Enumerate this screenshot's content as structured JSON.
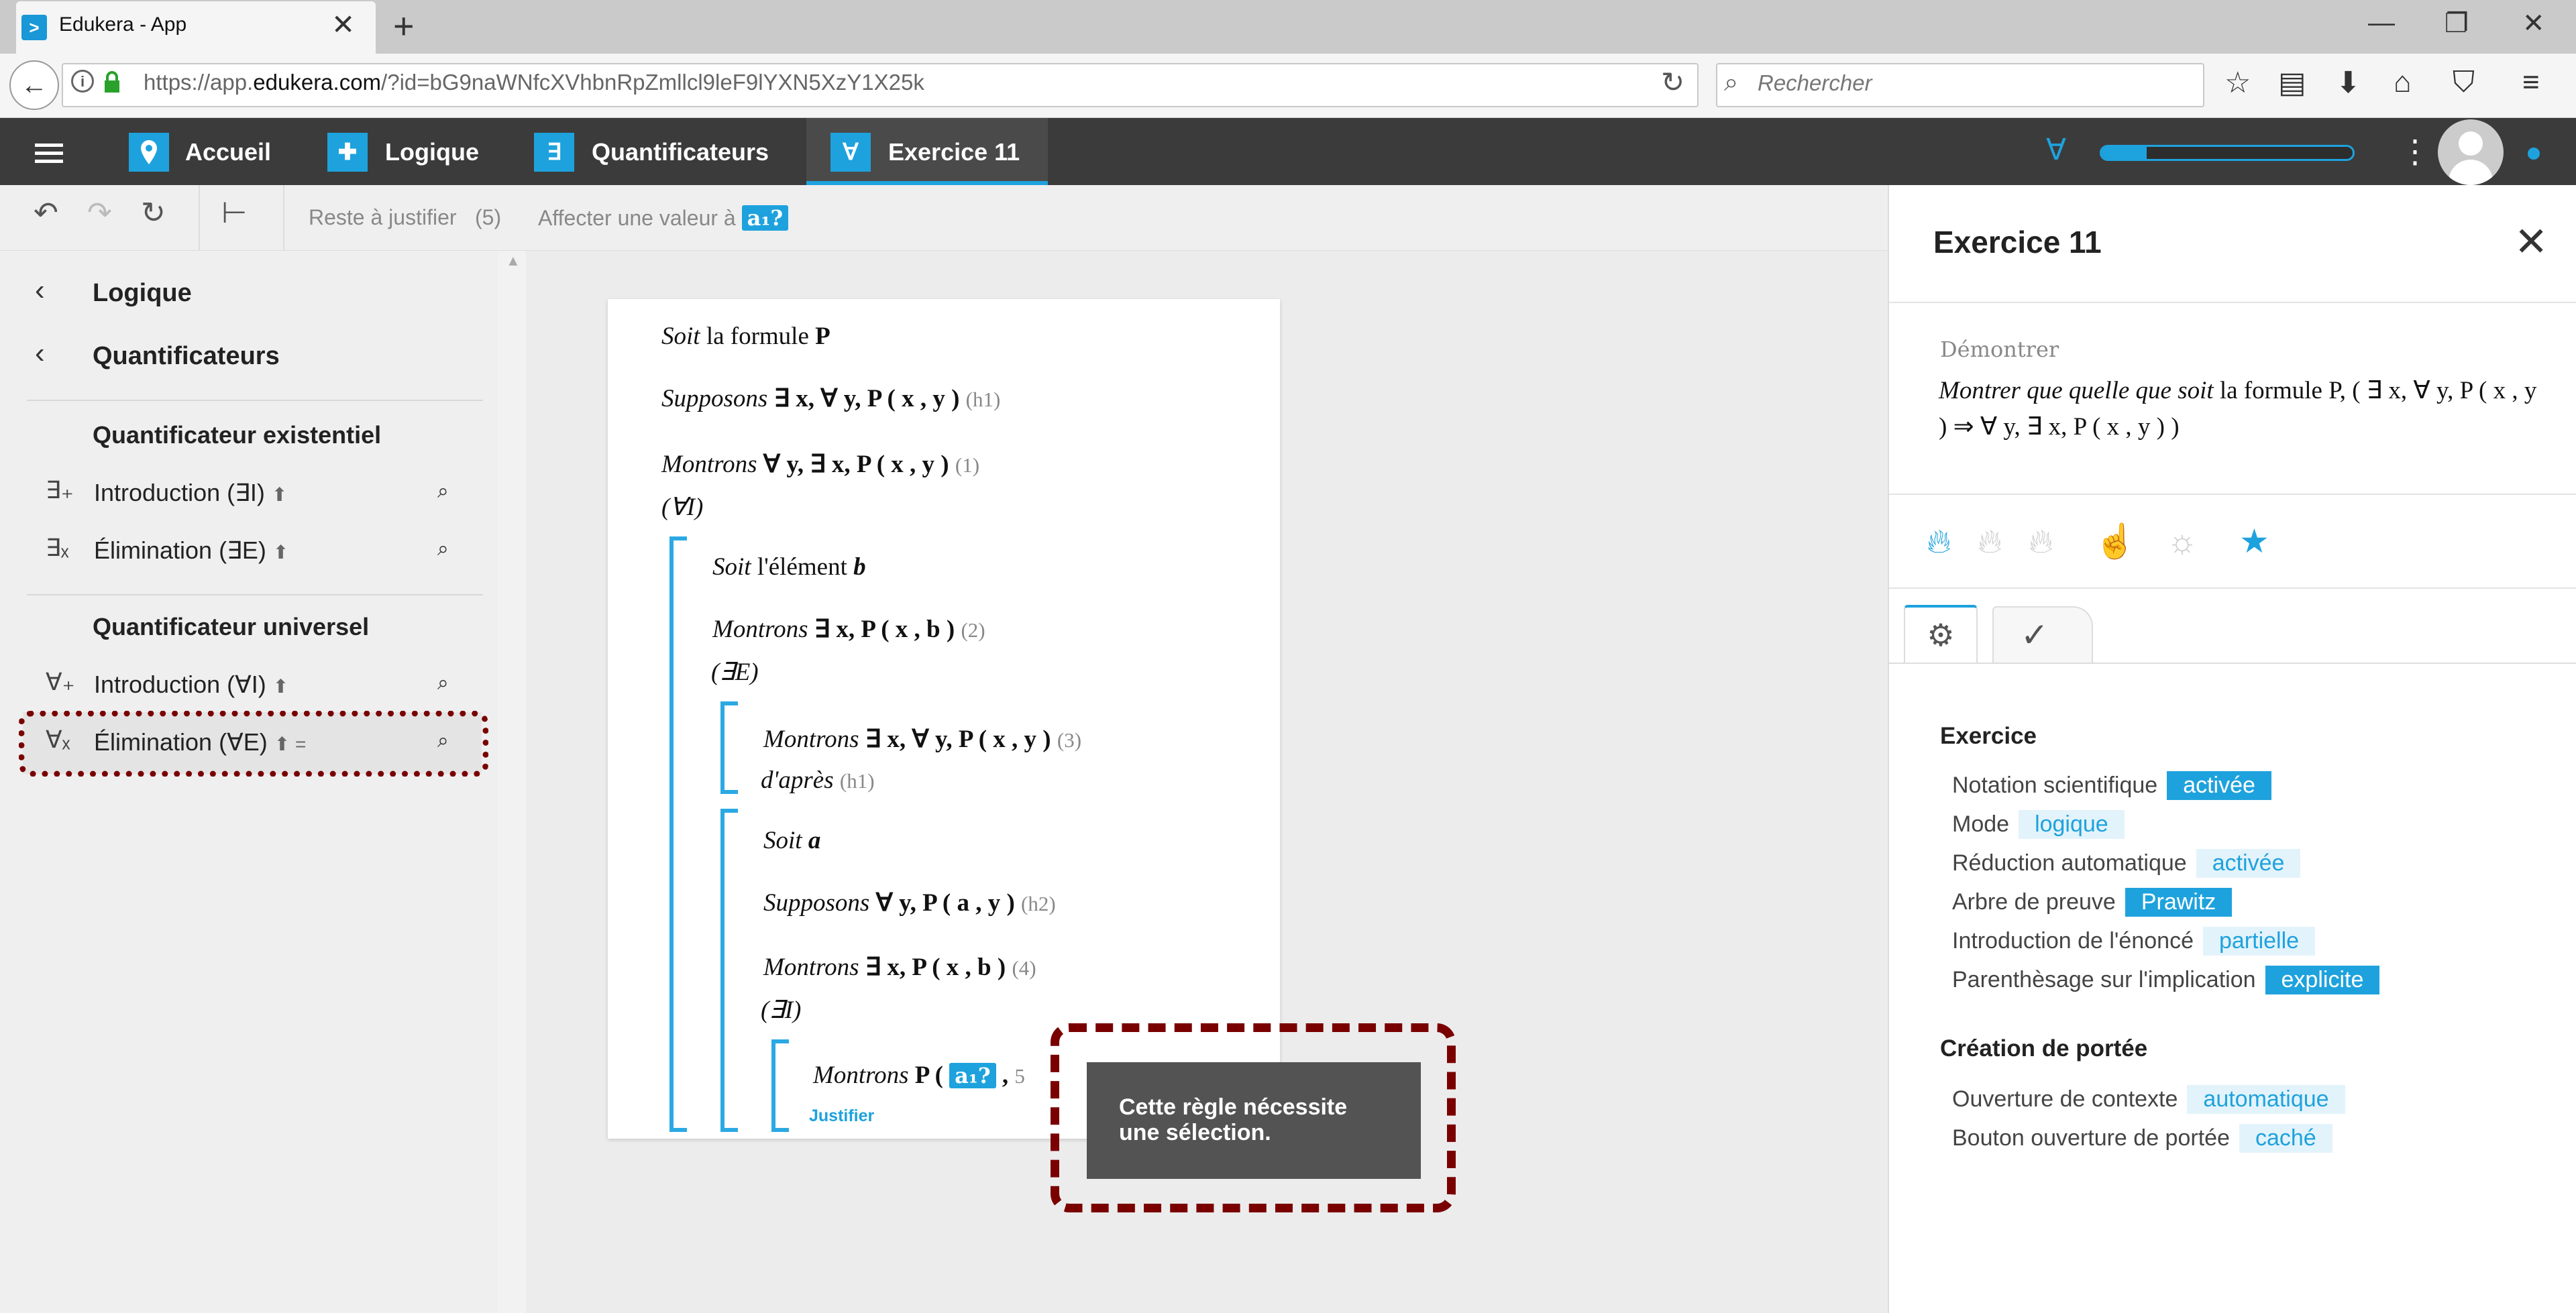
{
  "browser": {
    "tab_title": "Edukera - App",
    "url_prefix": "https://app.",
    "url_domain": "edukera.com",
    "url_rest": "/?id=bG9naWNfcXVhbnRpZmllcl9leF9lYXN5XzY1X25k",
    "search_placeholder": "Rechercher"
  },
  "header": {
    "crumbs": [
      {
        "label": "Accueil",
        "icon": "map-pin-icon"
      },
      {
        "label": "Logique",
        "icon": "puzzle-icon"
      },
      {
        "label": "Quantificateurs",
        "icon": "exists-icon",
        "symbol": "∃"
      },
      {
        "label": "Exercice 11",
        "icon": "forall-icon",
        "symbol": "∀"
      }
    ],
    "progress_fraction": 0.18,
    "forall_symbol": "∀"
  },
  "toolbar": {
    "reste_label": "Reste à justifier",
    "reste_count": "(5)",
    "affecter_label": "Affecter une valeur à",
    "affecter_var": "a₁?"
  },
  "sidebar": {
    "back1": "Logique",
    "back2": "Quantificateurs",
    "section1": "Quantificateur existentiel",
    "rules1": [
      {
        "sym": "∃₊",
        "label": "Introduction (∃I)",
        "mark": "⬆"
      },
      {
        "sym": "∃ₓ",
        "label": "Élimination (∃E)",
        "mark": "⬆"
      }
    ],
    "section2": "Quantificateur universel",
    "rules2": [
      {
        "sym": "∀₊",
        "label": "Introduction (∀I)",
        "mark": "⬆"
      },
      {
        "sym": "∀ₓ",
        "label": "Élimination (∀E)",
        "mark": "⬆ ="
      }
    ]
  },
  "proof": {
    "lines": [
      {
        "kw": "Soit",
        "text": " la formule ",
        "formula": "P",
        "label": ""
      },
      {
        "kw": "Supposons",
        "text": " ∃ x, ∀ y, P ( x , y )",
        "formula": "",
        "label": "(h1)"
      },
      {
        "kw": "Montrons",
        "text": " ∀ y, ∃ x, P ( x , y )",
        "formula": "",
        "label": "(1)"
      },
      {
        "kw": "",
        "text": "(∀I)",
        "formula": "",
        "label": ""
      },
      {
        "kw": "Soit",
        "text": " l'élément ",
        "formula": "b",
        "label": ""
      },
      {
        "kw": "Montrons",
        "text": " ∃ x, P ( x , b )",
        "formula": "",
        "label": "(2)"
      },
      {
        "kw": "",
        "text": "(∃E)",
        "formula": "",
        "label": ""
      },
      {
        "kw": "Montrons",
        "text": " ∃ x, ∀ y, P ( x , y )",
        "formula": "",
        "label": "(3)"
      },
      {
        "kw": "d'après",
        "text": " ",
        "formula": "",
        "label": "(h1)"
      },
      {
        "kw": "Soit",
        "text": " ",
        "formula": "a",
        "label": ""
      },
      {
        "kw": "Supposons",
        "text": " ∀ y, P ( a , y )",
        "formula": "",
        "label": "(h2)"
      },
      {
        "kw": "Montrons",
        "text": " ∃ x, P ( x , b )",
        "formula": "",
        "label": "(4)"
      },
      {
        "kw": "",
        "text": "(∃I)",
        "formula": "",
        "label": ""
      },
      {
        "kw": "Montrons",
        "text": " P (",
        "formula": "",
        "label": ""
      }
    ],
    "last_var": "a₁?",
    "last_tail": " , ",
    "last_label": "5",
    "justifier": "Justifier",
    "tooltip": "Cette règle nécessite une sélection."
  },
  "panel": {
    "title": "Exercice 11",
    "demontrer": "Démontrer",
    "statement_kw": "Montrer que quelle que soit",
    "statement_rest": " la formule P, ( ∃ x, ∀ y, P ( x , y ) ⇒ ∀ y, ∃ x, P ( x , y ) )",
    "difficulty_icons": [
      "flame-icon",
      "flame-icon",
      "flame-icon",
      "hand-icon",
      "bulb-icon",
      "star-icon"
    ],
    "section_exercice": "Exercice",
    "options": [
      {
        "label": "Notation scientifique",
        "value": "activée",
        "on": true
      },
      {
        "label": "Mode",
        "value": "logique",
        "on": false
      },
      {
        "label": "Réduction automatique",
        "value": "activée",
        "on": false
      },
      {
        "label": "Arbre de preuve",
        "value": "Prawitz",
        "on": true
      },
      {
        "label": "Introduction de l'énoncé",
        "value": "partielle",
        "on": false
      },
      {
        "label": "Parenthèsage sur l'implication",
        "value": "explicite",
        "on": true
      }
    ],
    "section_portee": "Création de portée",
    "options2": [
      {
        "label": "Ouverture de contexte",
        "value": "automatique",
        "on": false
      },
      {
        "label": "Bouton ouverture de portée",
        "value": "caché",
        "on": false
      }
    ]
  },
  "colors": {
    "accent": "#1ea2dd",
    "header": "#3b3b3b",
    "annotation": "#7a0000"
  }
}
